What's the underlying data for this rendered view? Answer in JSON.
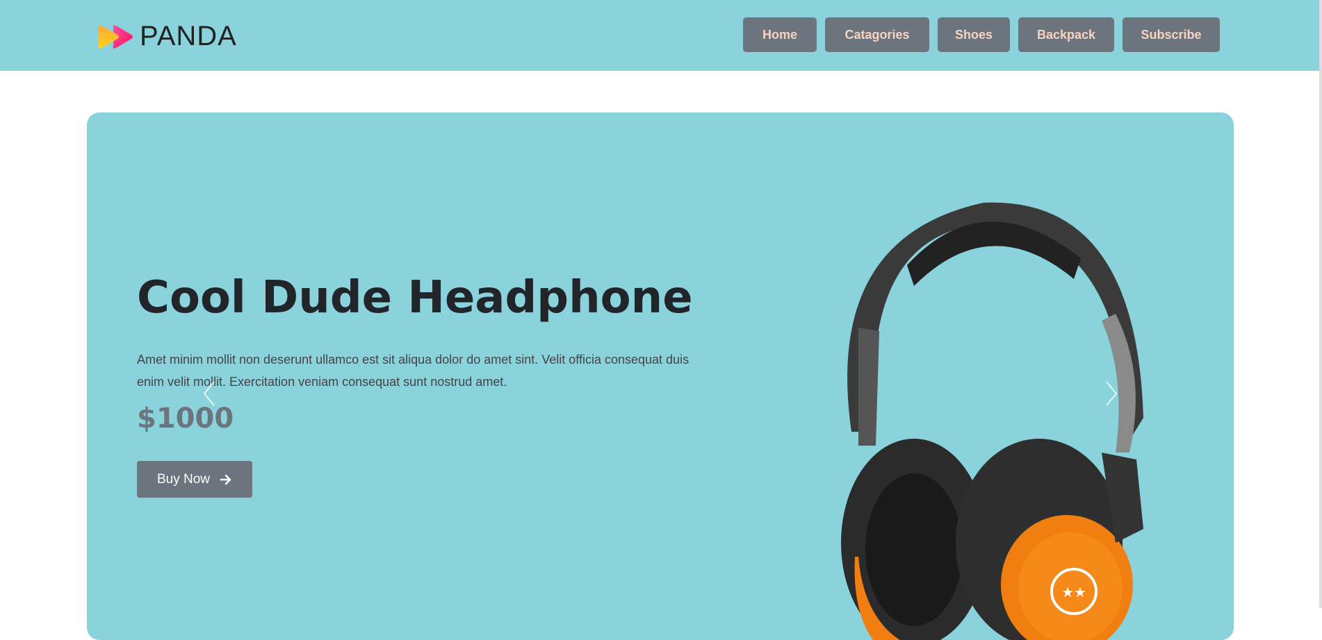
{
  "brand": {
    "name": "PANDA"
  },
  "nav": {
    "items": [
      {
        "label": "Home"
      },
      {
        "label": "Catagories"
      },
      {
        "label": "Shoes"
      },
      {
        "label": "Backpack"
      },
      {
        "label": "Subscribe"
      }
    ]
  },
  "hero": {
    "title": "Cool Dude Headphone",
    "description": "Amet minim mollit non deserunt ullamco est sit aliqua dolor do amet sint. Velit officia consequat duis enim velit mollit. Exercitation veniam consequat sunt nostrud amet.",
    "price": "$1000",
    "button_label": "Buy Now",
    "button_icon": "arrow-right-icon",
    "image": "headphone-image"
  },
  "colors": {
    "accent": "#8AD3DD",
    "button": "#6C757D",
    "nav_text": "#F8D3C2",
    "orange": "#F07E10"
  }
}
